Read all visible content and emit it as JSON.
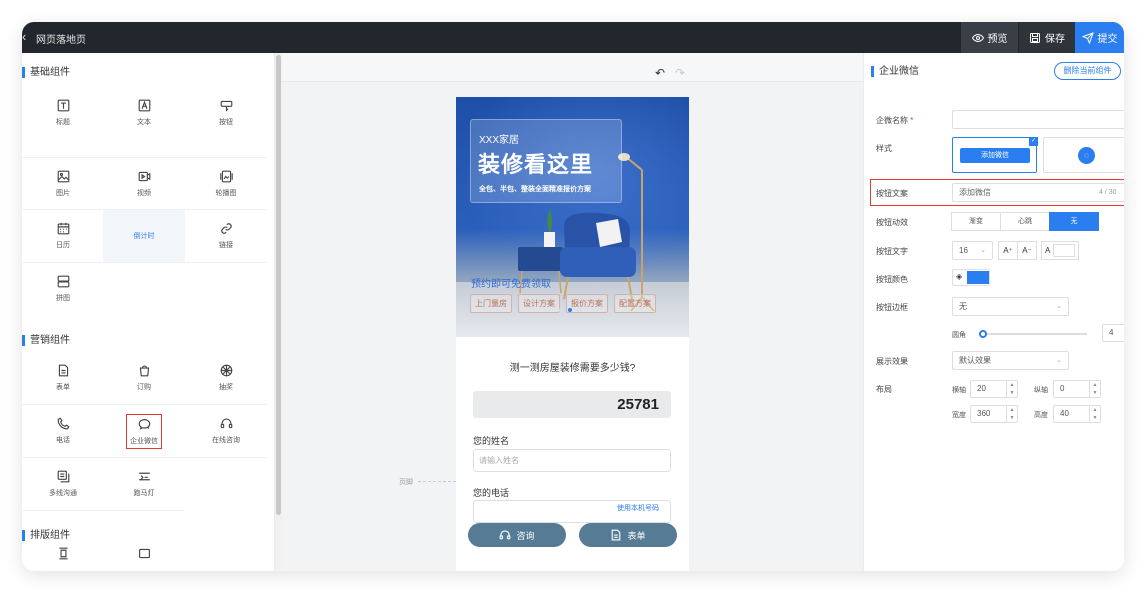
{
  "topbar": {
    "back_glyph": "‹",
    "title": "网页落地页",
    "preview": "预览",
    "save": "保存",
    "submit": "提交"
  },
  "left": {
    "basic_title": "基础组件",
    "marketing_title": "营销组件",
    "layout_title": "排版组件",
    "basic_items": [
      {
        "label": "标题",
        "icon": "title-icon"
      },
      {
        "label": "文本",
        "icon": "text-icon"
      },
      {
        "label": "按钮",
        "icon": "button-icon"
      },
      {
        "label": "图片",
        "icon": "image-icon"
      },
      {
        "label": "视频",
        "icon": "video-icon"
      },
      {
        "label": "轮播图",
        "icon": "carousel-icon"
      },
      {
        "label": "日历",
        "icon": "calendar-icon"
      },
      {
        "label": "倒计时",
        "icon": "countdown-icon"
      },
      {
        "label": "链接",
        "icon": "link-icon"
      },
      {
        "label": "拼图",
        "icon": "puzzle-icon"
      }
    ],
    "marketing_items": [
      {
        "label": "表单",
        "icon": "form-icon"
      },
      {
        "label": "订购",
        "icon": "order-icon"
      },
      {
        "label": "抽奖",
        "icon": "lottery-icon"
      },
      {
        "label": "电话",
        "icon": "phone-icon"
      },
      {
        "label": "企业微信",
        "icon": "wecom-icon"
      },
      {
        "label": "在线咨询",
        "icon": "headset-icon"
      },
      {
        "label": "多线沟通",
        "icon": "multichat-icon"
      },
      {
        "label": "跑马灯",
        "icon": "marquee-icon"
      }
    ]
  },
  "canvas": {
    "undo_glyph": "↶",
    "redo_glyph": "↷",
    "footer_marker": "页脚",
    "banner": {
      "brand": "XXX家居",
      "headline": "装修看这里",
      "subline": "全包、半包、整装全面精准报价方案",
      "cta": "预约即可免费领取",
      "tags": [
        "上门量房",
        "设计方案",
        "报价方案",
        "配置方案"
      ]
    },
    "calc_title": "测一测房屋装修需要多少钱?",
    "calc_value": "25781",
    "name_label": "您的姓名",
    "name_placeholder": "请输入姓名",
    "phone_label": "您的电话",
    "phone_link": "使用本机号码",
    "btn_consult": "咨询",
    "btn_form": "表单"
  },
  "right": {
    "title": "企业微信",
    "delete": "删除当前组件",
    "name_label": "企微名称",
    "style_label": "样式",
    "style_btn_text": "添加微信",
    "style_selected_check": "✓",
    "btn_text_label": "按钮文案",
    "btn_text_value": "添加微信",
    "btn_text_counter": "4 / 30",
    "anim_label": "按钮动效",
    "anim_options": [
      "渐变",
      "心跳",
      "无"
    ],
    "font_label": "按钮文字",
    "font_size": "16",
    "font_inc": "A⁺",
    "font_dec": "A⁻",
    "font_color_glyph": "A",
    "color_label": "按钮颜色",
    "color_value": "#2a7ef0",
    "border_label": "按钮边框",
    "border_value": "无",
    "radius_label": "圆角",
    "radius_value": "4",
    "display_label": "展示效果",
    "display_value": "默认效果",
    "layout_label": "布局",
    "x_label": "横轴",
    "x_value": "20",
    "y_label": "纵轴",
    "y_value": "0",
    "w_label": "宽度",
    "w_value": "360",
    "h_label": "高度",
    "h_value": "40"
  }
}
